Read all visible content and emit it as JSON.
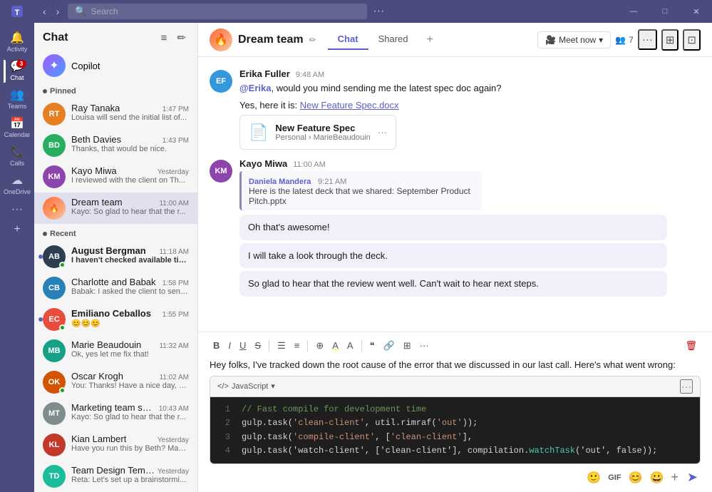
{
  "app": {
    "title": "Microsoft Teams",
    "search_placeholder": "Search"
  },
  "window_controls": {
    "minimize": "—",
    "maximize": "□",
    "close": "✕",
    "more": "···"
  },
  "nav": {
    "items": [
      {
        "id": "activity",
        "label": "Activity",
        "icon": "🔔",
        "badge": null
      },
      {
        "id": "chat",
        "label": "Chat",
        "icon": "💬",
        "badge": "3",
        "active": true
      },
      {
        "id": "teams",
        "label": "Teams",
        "icon": "👥",
        "badge": null
      },
      {
        "id": "calendar",
        "label": "Calendar",
        "icon": "📅",
        "badge": null
      },
      {
        "id": "calls",
        "label": "Calls",
        "icon": "📞",
        "badge": null
      },
      {
        "id": "onedrive",
        "label": "OneDrive",
        "icon": "☁",
        "badge": null
      }
    ],
    "more": "···",
    "add": "+"
  },
  "chat_panel": {
    "title": "Chat",
    "filter_icon": "≡",
    "compose_icon": "✏",
    "copilot": {
      "label": "Copilot",
      "icon": "✦"
    },
    "sections": {
      "pinned": {
        "label": "Pinned",
        "items": [
          {
            "id": "ray",
            "name": "Ray Tanaka",
            "preview": "Louisa will send the initial list of...",
            "time": "1:47 PM",
            "av_class": "av-ray",
            "av_text": "RT",
            "unread": false
          },
          {
            "id": "beth",
            "name": "Beth Davies",
            "preview": "Thanks, that would be nice.",
            "time": "1:43 PM",
            "av_class": "av-beth",
            "av_text": "BD",
            "unread": false
          },
          {
            "id": "kayo",
            "name": "Kayo Miwa",
            "preview": "I reviewed with the client on Th...",
            "time": "Yesterday",
            "av_class": "av-kayo",
            "av_text": "KM",
            "unread": false
          },
          {
            "id": "dream",
            "name": "Dream team",
            "preview": "Kayo: So glad to hear that the r...",
            "time": "11:00 AM",
            "av_class": "av-dream",
            "av_text": "🔥",
            "unread": false,
            "active": true
          }
        ]
      },
      "recent": {
        "label": "Recent",
        "items": [
          {
            "id": "aug",
            "name": "August Bergman",
            "preview": "I haven't checked available tim...",
            "time": "11:18 AM",
            "av_class": "av-aug",
            "av_text": "AB",
            "unread": true,
            "status": "online"
          },
          {
            "id": "char",
            "name": "Charlotte and Babak",
            "preview": "Babak: I asked the client to send...",
            "time": "1:58 PM",
            "av_class": "av-char",
            "av_text": "CB",
            "unread": false
          },
          {
            "id": "emi",
            "name": "Emiliano Ceballos",
            "preview": "😊😊😊",
            "time": "1:55 PM",
            "av_class": "av-emi",
            "av_text": "EC",
            "unread": true,
            "status": "online"
          },
          {
            "id": "marie",
            "name": "Marie Beaudouin",
            "preview": "Ok, yes let me fix that!",
            "time": "11:32 AM",
            "av_class": "av-marie",
            "av_text": "MB",
            "unread": false
          },
          {
            "id": "oscar",
            "name": "Oscar Krogh",
            "preview": "You: Thanks! Have a nice day, Bi...",
            "time": "11:02 AM",
            "av_class": "av-oscar",
            "av_text": "OK",
            "unread": false,
            "status": "online"
          },
          {
            "id": "mkt",
            "name": "Marketing team sync",
            "preview": "Kayo: So glad to hear that the r...",
            "time": "10:43 AM",
            "av_class": "av-mkt",
            "av_text": "MT",
            "unread": false
          },
          {
            "id": "kian",
            "name": "Kian Lambert",
            "preview": "Have you run this by Beth? Mak...",
            "time": "Yesterday",
            "av_class": "av-kian",
            "av_text": "KL",
            "unread": false
          },
          {
            "id": "team2",
            "name": "Team Design Template",
            "preview": "Reta: Let's set up a brainstormi...",
            "time": "Yesterday",
            "av_class": "av-team",
            "av_text": "TD",
            "unread": false
          }
        ]
      }
    }
  },
  "channel": {
    "name": "Dream team",
    "avatar_emoji": "🔥",
    "edit_icon": "✏",
    "tabs": [
      {
        "id": "chat",
        "label": "Chat",
        "active": true
      },
      {
        "id": "shared",
        "label": "Shared",
        "active": false
      }
    ],
    "add_tab_icon": "+",
    "actions": {
      "meet_now": "Meet now",
      "meet_chevron": "▾",
      "participants": "7",
      "more": "···",
      "screenshare": "⊞",
      "popout": "⊡"
    }
  },
  "messages": [
    {
      "id": "msg1",
      "sender": "Erika",
      "full_name": "Erika Fuller",
      "time": "9:48 AM",
      "av_class": "av-erika",
      "av_text": "EF",
      "text_before": ", would you mind sending me the latest spec doc again?",
      "mention": "Erika",
      "file": {
        "name": "New Feature Spec",
        "path": "Personal › MarieBeaudouin",
        "icon": "📄"
      },
      "file_link": "New Feature Spec.docx"
    },
    {
      "id": "msg2",
      "sender": "Kayo Miwa",
      "time": "11:00 AM",
      "av_class": "av-msg-kayo",
      "av_text": "KM",
      "quoted": {
        "sender": "Daniela Mandera",
        "time": "9:21 AM",
        "text": "Here is the latest deck that we shared: September Product Pitch.pptx"
      },
      "messages": [
        "Oh that's awesome!",
        "I will take a look through the deck.",
        "So glad to hear that the review went well. Can't wait to hear next steps."
      ]
    }
  ],
  "compose": {
    "toolbar": {
      "bold": "B",
      "italic": "I",
      "underline": "U",
      "strikethrough": "S",
      "bullets": "☰",
      "numbering": "≡",
      "more1": "⊕",
      "highlight": "A",
      "font_size": "A",
      "quote": "❝",
      "link": "🔗",
      "table": "⊞",
      "more2": "···",
      "delete": "🗑"
    },
    "body_text": "Hey folks, I've tracked down the root cause of the error that we discussed in our last call. Here's what went wrong:",
    "code_block": {
      "lang": "JavaScript",
      "lang_icon": "</>",
      "more": "···",
      "lines": [
        {
          "num": "1",
          "code": "  // Fast compile for development time",
          "type": "comment"
        },
        {
          "num": "2",
          "code": "  gulp.task('clean-client', util.rimraf('out'));",
          "type": "normal"
        },
        {
          "num": "3",
          "code": "  gulp.task('compile-client', ['clean-client'],",
          "type": "normal"
        },
        {
          "num": "4",
          "code": "  gulp.task('watch-client', ['clean-client'], compilation.watchTask('out', false));",
          "type": "watch"
        }
      ]
    },
    "footer": {
      "emoji": "😊",
      "gif": "GIF",
      "sticker": "🙂",
      "emoji2": "😀",
      "add": "+",
      "send": "➤"
    }
  }
}
